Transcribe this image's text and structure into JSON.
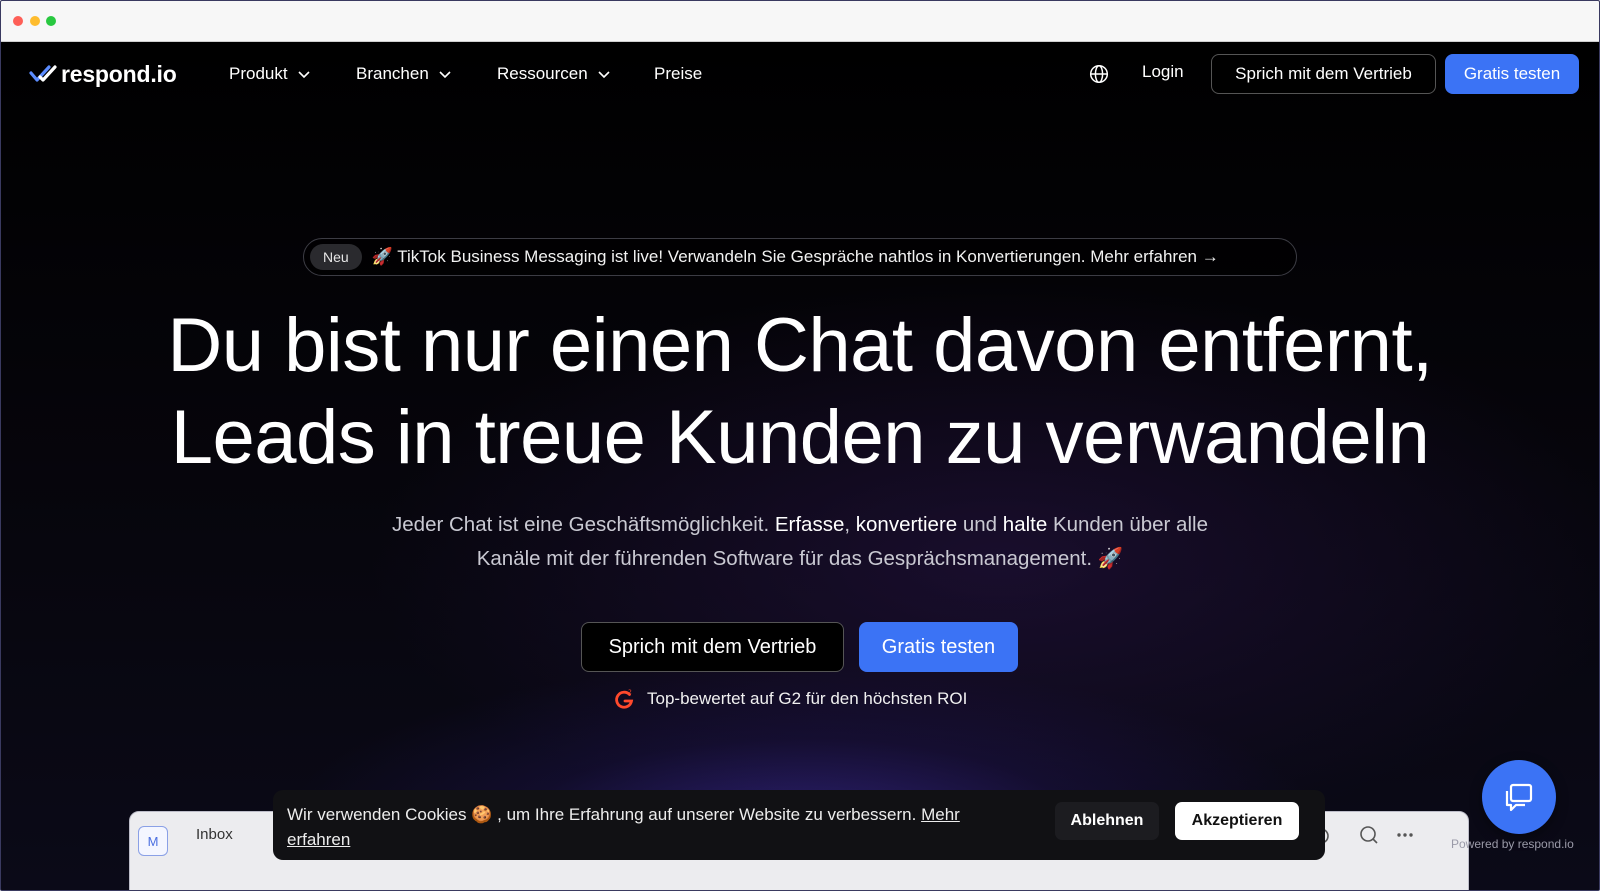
{
  "window": {
    "controls": [
      "close",
      "minimize",
      "maximize"
    ]
  },
  "nav": {
    "logo_text": "respond.io",
    "items": [
      {
        "label": "Produkt",
        "has_dropdown": true
      },
      {
        "label": "Branchen",
        "has_dropdown": true
      },
      {
        "label": "Ressourcen",
        "has_dropdown": true
      },
      {
        "label": "Preise",
        "has_dropdown": false
      }
    ],
    "login": "Login",
    "sales_button": "Sprich mit dem Vertrieb",
    "trial_button": "Gratis testen"
  },
  "announcement": {
    "badge": "Neu",
    "text": "🚀 TikTok Business Messaging ist live! Verwandeln Sie Gespräche nahtlos in Konvertierungen. Mehr erfahren →"
  },
  "hero": {
    "headline_line1": "Du bist nur einen Chat davon entfernt,",
    "headline_line2": "Leads in treue Kunden zu verwandeln",
    "sub_part1": "Jeder Chat ist eine Geschäftsmöglichkeit. ",
    "sub_bold1": "Erfasse",
    "sub_part2": ", ",
    "sub_bold2": "konvertiere",
    "sub_part3": " und ",
    "sub_bold3": "halte",
    "sub_part4": " Kunden über alle",
    "sub_line2": "Kanäle mit der führenden Software für das Gesprächsmanagement. 🚀",
    "sales_button": "Sprich mit dem Vertrieb",
    "trial_button": "Gratis testen",
    "g2_text": "Top-bewertet auf G2 für den höchsten ROI"
  },
  "preview": {
    "avatar_letter": "M",
    "inbox_label": "Inbox"
  },
  "cookie": {
    "text": "Wir verwenden Cookies 🍪 , um Ihre Erfahrung auf unserer Website zu verbessern. ",
    "link": "Mehr erfahren",
    "decline": "Ablehnen",
    "accept": "Akzeptieren"
  },
  "chat_widget": {
    "powered_by": "Powered by respond.io"
  },
  "colors": {
    "accent": "#3b73f5",
    "background": "#000000",
    "g2": "#ff492c"
  }
}
